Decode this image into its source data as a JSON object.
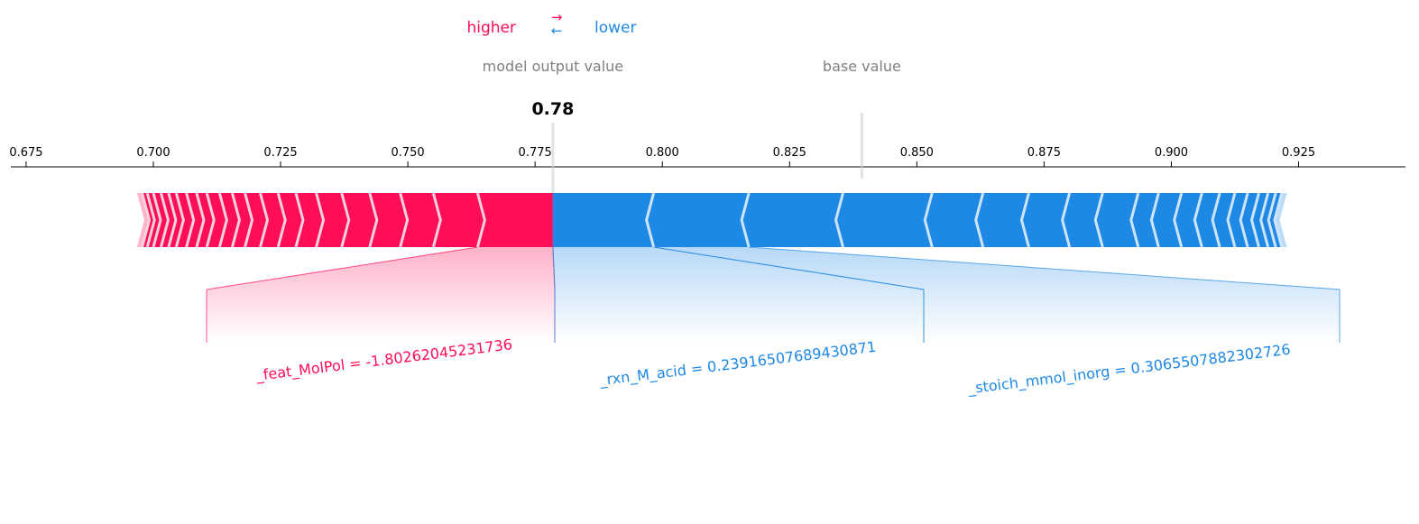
{
  "legend": {
    "higher": "higher",
    "lower": "lower",
    "arrow_right": "→",
    "arrow_left": "←"
  },
  "labels": {
    "output": "model output value",
    "base": "base value",
    "output_value_text": "0.78"
  },
  "colors": {
    "positive": "#ff0d57",
    "negative": "#1e88e5",
    "label_gray": "#808080",
    "axis": "#000000"
  },
  "chart_data": {
    "type": "force",
    "output_value": 0.7785,
    "base_value": 0.8392,
    "xlim": [
      0.672,
      0.946
    ],
    "ticks": [
      {
        "value": 0.675,
        "label": "0.675"
      },
      {
        "value": 0.7,
        "label": "0.700"
      },
      {
        "value": 0.725,
        "label": "0.725"
      },
      {
        "value": 0.75,
        "label": "0.750"
      },
      {
        "value": 0.775,
        "label": "0.775"
      },
      {
        "value": 0.8,
        "label": "0.800"
      },
      {
        "value": 0.825,
        "label": "0.825"
      },
      {
        "value": 0.85,
        "label": "0.850"
      },
      {
        "value": 0.875,
        "label": "0.875"
      },
      {
        "value": 0.9,
        "label": "0.900"
      },
      {
        "value": 0.925,
        "label": "0.925"
      }
    ],
    "positive_boundaries": [
      0.7785,
      0.7637,
      0.755,
      0.7485,
      0.7425,
      0.737,
      0.732,
      0.728,
      0.7245,
      0.721,
      0.718,
      0.7155,
      0.713,
      0.7105,
      0.7085,
      0.7065,
      0.7045,
      0.703,
      0.7015,
      0.7,
      0.6988,
      0.6978,
      0.6968
    ],
    "negative_boundaries": [
      0.7785,
      0.7983,
      0.817,
      0.8355,
      0.853,
      0.863,
      0.872,
      0.88,
      0.8865,
      0.8935,
      0.8975,
      0.902,
      0.906,
      0.9095,
      0.9125,
      0.915,
      0.9172,
      0.919,
      0.9205,
      0.9217,
      0.9227
    ],
    "labeled_features": [
      {
        "text": "_feat_MolPol = -1.80262045231736",
        "side": "positive",
        "start": 0.7785,
        "end": 0.7637
      },
      {
        "text": "_rxn_M_acid = 0.23916507689430871",
        "side": "negative",
        "start": 0.7785,
        "end": 0.7983
      },
      {
        "text": "_stoich_mmol_inorg = 0.3065507882302726",
        "side": "negative",
        "start": 0.7983,
        "end": 0.817
      }
    ]
  }
}
